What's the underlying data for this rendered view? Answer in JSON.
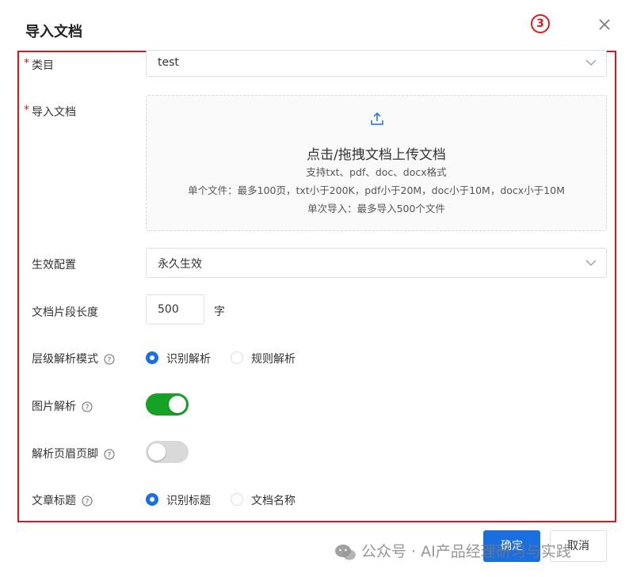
{
  "dialog": {
    "title": "导入文档",
    "step_badge": "3"
  },
  "form": {
    "category": {
      "label": "类目",
      "value": "test"
    },
    "import_doc": {
      "label": "导入文档",
      "main_text": "点击/拖拽文档上传文档",
      "formats": "支持txt、pdf、doc、docx格式",
      "size_limits": "单个文件：最多100页，txt小于200K，pdf小于20M，doc小于10M，docx小于10M",
      "batch_limit": "单次导入：最多导入500个文件"
    },
    "effective_config": {
      "label": "生效配置",
      "value": "永久生效"
    },
    "chunk_length": {
      "label": "文档片段长度",
      "value": "500",
      "unit": "字"
    },
    "level_parse_mode": {
      "label": "层级解析模式",
      "options": [
        "识别解析",
        "规则解析"
      ],
      "selected": "识别解析"
    },
    "image_parse": {
      "label": "图片解析",
      "enabled": true
    },
    "header_footer_parse": {
      "label": "解析页眉页脚",
      "enabled": false
    },
    "article_title": {
      "label": "文章标题",
      "options": [
        "识别标题",
        "文档名称"
      ],
      "selected": "识别标题"
    }
  },
  "footer": {
    "confirm_label": "确定",
    "cancel_label": "取消"
  },
  "watermark": {
    "text": "公众号 · AI产品经理研习与实践"
  },
  "colors": {
    "primary": "#1a6fe0",
    "toggle_on": "#16a325",
    "toggle_off": "#d9d9d9",
    "highlight": "#d9161d"
  }
}
